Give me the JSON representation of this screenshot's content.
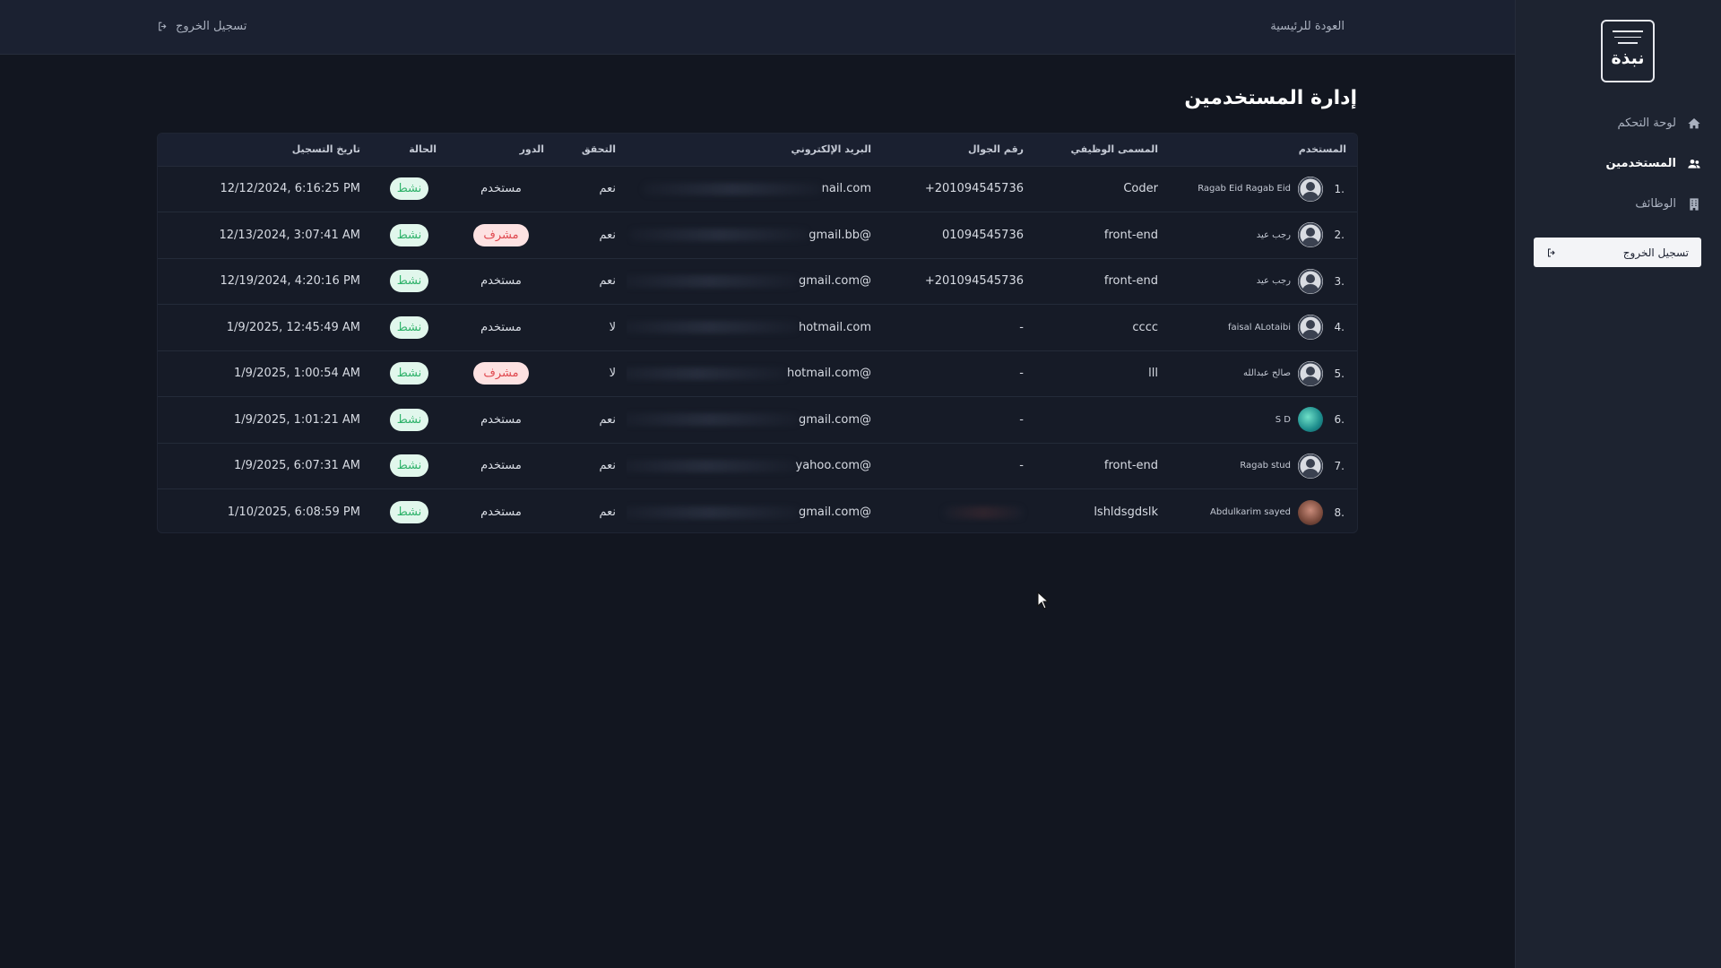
{
  "brand": {
    "logo_text": "نبذة"
  },
  "sidebar": {
    "items": [
      {
        "label": "لوحة التحكم",
        "icon": "home-icon",
        "active": false
      },
      {
        "label": "المستخدمين",
        "icon": "users-icon",
        "active": true
      },
      {
        "label": "الوظائف",
        "icon": "building-icon",
        "active": false
      }
    ],
    "logout_label": "تسجيل الخروج"
  },
  "topbar": {
    "home_label": "العودة للرئيسية",
    "logout_label": "تسجيل الخروج"
  },
  "page": {
    "title": "إدارة المستخدمين"
  },
  "table": {
    "headers": {
      "user": "المستخدم",
      "job": "المسمى الوظيفي",
      "phone": "رقم الجوال",
      "email": "البريد الإلكتروني",
      "verified": "التحقق",
      "role": "الدور",
      "status": "الحالة",
      "registered": "تاريخ التسجيل"
    },
    "rows": [
      {
        "index": ".1",
        "avatar": "default",
        "name": "Ragab Eid Ragab Eid",
        "job": "Coder",
        "phone": "201094545736+",
        "email": "nail.com",
        "verified": "نعم",
        "role": "مستخدم",
        "role_type": "user",
        "status": "نشط",
        "registered": "12/12/2024, 6:16:25 PM"
      },
      {
        "index": ".2",
        "avatar": "default",
        "name": "رجب عيد",
        "job": "front-end",
        "phone": "01094545736",
        "email": "@gmail.bb",
        "verified": "نعم",
        "role": "مشرف",
        "role_type": "admin",
        "status": "نشط",
        "registered": "12/13/2024, 3:07:41 AM"
      },
      {
        "index": ".3",
        "avatar": "default",
        "name": "رجب عيد",
        "job": "front-end",
        "phone": "201094545736+",
        "email": "@gmail.com",
        "verified": "نعم",
        "role": "مستخدم",
        "role_type": "user",
        "status": "نشط",
        "registered": "12/19/2024, 4:20:16 PM"
      },
      {
        "index": ".4",
        "avatar": "default",
        "name": "faisal ALotaibi",
        "job": "cccc",
        "phone": "-",
        "email": "hotmail.com",
        "verified": "لا",
        "role": "مستخدم",
        "role_type": "user",
        "status": "نشط",
        "registered": "1/9/2025, 12:45:49 AM"
      },
      {
        "index": ".5",
        "avatar": "default",
        "name": "صالح عبدالله",
        "job": "lll",
        "phone": "-",
        "email": "@hotmail.com",
        "verified": "لا",
        "role": "مشرف",
        "role_type": "admin",
        "status": "نشط",
        "registered": "1/9/2025, 1:00:54 AM"
      },
      {
        "index": ".6",
        "avatar": "photo-green",
        "name": "S D",
        "job": "",
        "phone": "-",
        "email": "@gmail.com",
        "verified": "نعم",
        "role": "مستخدم",
        "role_type": "user",
        "status": "نشط",
        "registered": "1/9/2025, 1:01:21 AM"
      },
      {
        "index": ".7",
        "avatar": "default",
        "name": "Ragab stud",
        "job": "front-end",
        "phone": "-",
        "email": "@yahoo.com",
        "verified": "نعم",
        "role": "مستخدم",
        "role_type": "user",
        "status": "نشط",
        "registered": "1/9/2025, 6:07:31 AM"
      },
      {
        "index": ".8",
        "avatar": "photo-brown",
        "name": "Abdulkarim sayed",
        "job": "lshldsgdslk",
        "phone": "",
        "email": "@gmail.com",
        "verified": "نعم",
        "role": "مستخدم",
        "role_type": "user",
        "status": "نشط",
        "registered": "1/10/2025, 6:08:59 PM"
      }
    ]
  },
  "colors": {
    "background": "#121620",
    "sidebar": "#1d2330",
    "status_active_bg": "#e1f7ec",
    "status_active_fg": "#2fb26a",
    "admin_bg": "#fde2e2",
    "admin_fg": "#e0484f"
  }
}
